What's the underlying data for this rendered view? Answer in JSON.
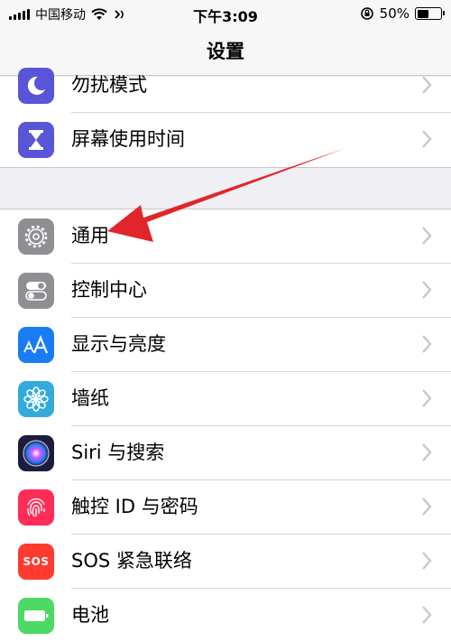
{
  "status_bar": {
    "carrier": "中国移动",
    "time": "下午3:09",
    "battery_percent": "50%",
    "battery_level": 0.5
  },
  "nav": {
    "title": "设置"
  },
  "group1": [
    {
      "label": "勿扰模式",
      "icon": "moon-icon",
      "color": "#5856d6"
    },
    {
      "label": "屏幕使用时间",
      "icon": "hourglass-icon",
      "color": "#5856d6"
    }
  ],
  "group2": [
    {
      "label": "通用",
      "icon": "gear-icon",
      "color": "#8e8e93"
    },
    {
      "label": "控制中心",
      "icon": "toggles-icon",
      "color": "#8e8e93"
    },
    {
      "label": "显示与亮度",
      "icon": "text-size-icon",
      "color": "#1a7cf5"
    },
    {
      "label": "墙纸",
      "icon": "flower-icon",
      "color": "#34aadc"
    },
    {
      "label": "Siri 与搜索",
      "icon": "siri-icon",
      "color": "#1c1c3c"
    },
    {
      "label": "触控 ID 与密码",
      "icon": "fingerprint-icon",
      "color": "#ff2d55"
    },
    {
      "label": "SOS 紧急联络",
      "icon": "sos-icon",
      "color": "#ff3b30",
      "icon_text": "SOS"
    },
    {
      "label": "电池",
      "icon": "battery-icon",
      "color": "#4cd964"
    }
  ],
  "annotation": {
    "arrow_color": "#e0262a",
    "points_to": "通用"
  }
}
